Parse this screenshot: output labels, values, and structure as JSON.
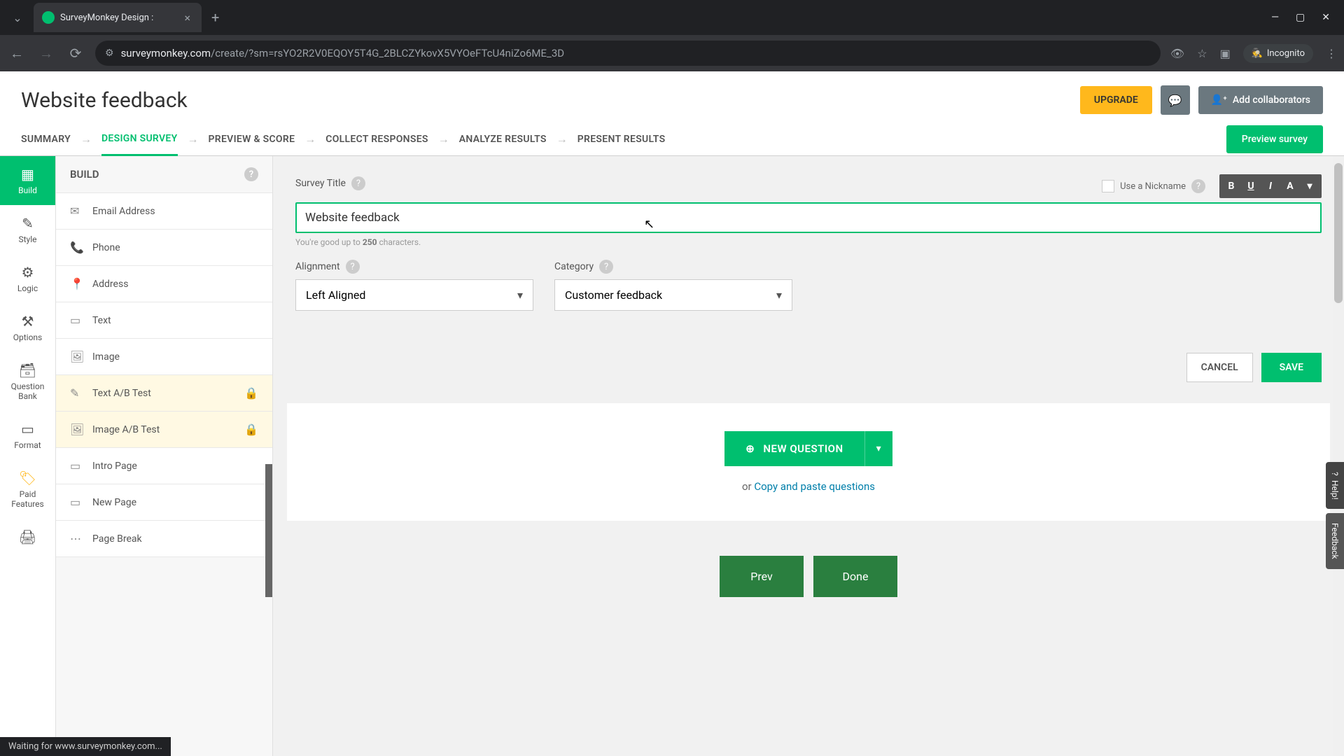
{
  "browser": {
    "tab_title": "SurveyMonkey Design :",
    "url_domain": "surveymonkey.com",
    "url_path": "/create/?sm=rsYO2R2V0EQOY5T4G_2BLCZYkovX5VYOeFTcU4niZo6ME_3D",
    "incognito_label": "Incognito",
    "status_text": "Waiting for www.surveymonkey.com..."
  },
  "header": {
    "survey_name": "Website feedback",
    "upgrade": "UPGRADE",
    "collab": "Add collaborators"
  },
  "tabs": {
    "summary": "SUMMARY",
    "design": "DESIGN SURVEY",
    "preview_score": "PREVIEW & SCORE",
    "collect": "COLLECT RESPONSES",
    "analyze": "ANALYZE RESULTS",
    "present": "PRESENT RESULTS",
    "preview_btn": "Preview survey"
  },
  "rail": {
    "build": "Build",
    "style": "Style",
    "logic": "Logic",
    "options": "Options",
    "qbank": "Question Bank",
    "format": "Format",
    "paid": "Paid Features"
  },
  "build_panel": {
    "title": "BUILD",
    "items": {
      "email": "Email Address",
      "phone": "Phone",
      "address": "Address",
      "text": "Text",
      "image": "Image",
      "text_ab": "Text A/B Test",
      "image_ab": "Image A/B Test",
      "intro": "Intro Page",
      "newpage": "New Page",
      "pagebreak": "Page Break"
    }
  },
  "editor": {
    "title_label": "Survey Title",
    "title_value": "Website feedback",
    "nickname_label": "Use a Nickname",
    "char_hint_pre": "You're good up to ",
    "char_hint_num": "250",
    "char_hint_post": " characters.",
    "alignment_label": "Alignment",
    "alignment_value": "Left Aligned",
    "category_label": "Category",
    "category_value": "Customer feedback",
    "cancel": "CANCEL",
    "save": "SAVE",
    "new_question": "NEW QUESTION",
    "or_text": "or ",
    "paste_link": "Copy and paste questions",
    "prev": "Prev",
    "done": "Done"
  },
  "side": {
    "help": "Help!",
    "feedback": "Feedback"
  }
}
